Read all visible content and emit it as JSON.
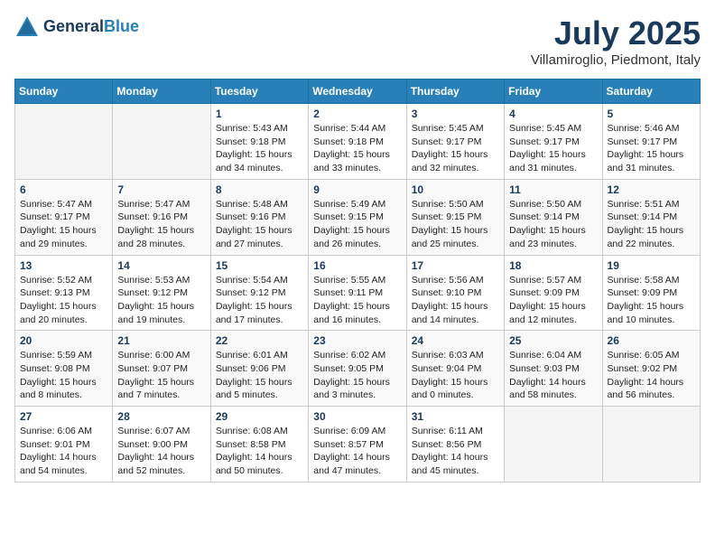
{
  "header": {
    "logo_line1": "General",
    "logo_line2": "Blue",
    "month_title": "July 2025",
    "location": "Villamiroglio, Piedmont, Italy"
  },
  "weekdays": [
    "Sunday",
    "Monday",
    "Tuesday",
    "Wednesday",
    "Thursday",
    "Friday",
    "Saturday"
  ],
  "weeks": [
    [
      {
        "day": "",
        "text": ""
      },
      {
        "day": "",
        "text": ""
      },
      {
        "day": "1",
        "text": "Sunrise: 5:43 AM\nSunset: 9:18 PM\nDaylight: 15 hours\nand 34 minutes."
      },
      {
        "day": "2",
        "text": "Sunrise: 5:44 AM\nSunset: 9:18 PM\nDaylight: 15 hours\nand 33 minutes."
      },
      {
        "day": "3",
        "text": "Sunrise: 5:45 AM\nSunset: 9:17 PM\nDaylight: 15 hours\nand 32 minutes."
      },
      {
        "day": "4",
        "text": "Sunrise: 5:45 AM\nSunset: 9:17 PM\nDaylight: 15 hours\nand 31 minutes."
      },
      {
        "day": "5",
        "text": "Sunrise: 5:46 AM\nSunset: 9:17 PM\nDaylight: 15 hours\nand 31 minutes."
      }
    ],
    [
      {
        "day": "6",
        "text": "Sunrise: 5:47 AM\nSunset: 9:17 PM\nDaylight: 15 hours\nand 29 minutes."
      },
      {
        "day": "7",
        "text": "Sunrise: 5:47 AM\nSunset: 9:16 PM\nDaylight: 15 hours\nand 28 minutes."
      },
      {
        "day": "8",
        "text": "Sunrise: 5:48 AM\nSunset: 9:16 PM\nDaylight: 15 hours\nand 27 minutes."
      },
      {
        "day": "9",
        "text": "Sunrise: 5:49 AM\nSunset: 9:15 PM\nDaylight: 15 hours\nand 26 minutes."
      },
      {
        "day": "10",
        "text": "Sunrise: 5:50 AM\nSunset: 9:15 PM\nDaylight: 15 hours\nand 25 minutes."
      },
      {
        "day": "11",
        "text": "Sunrise: 5:50 AM\nSunset: 9:14 PM\nDaylight: 15 hours\nand 23 minutes."
      },
      {
        "day": "12",
        "text": "Sunrise: 5:51 AM\nSunset: 9:14 PM\nDaylight: 15 hours\nand 22 minutes."
      }
    ],
    [
      {
        "day": "13",
        "text": "Sunrise: 5:52 AM\nSunset: 9:13 PM\nDaylight: 15 hours\nand 20 minutes."
      },
      {
        "day": "14",
        "text": "Sunrise: 5:53 AM\nSunset: 9:12 PM\nDaylight: 15 hours\nand 19 minutes."
      },
      {
        "day": "15",
        "text": "Sunrise: 5:54 AM\nSunset: 9:12 PM\nDaylight: 15 hours\nand 17 minutes."
      },
      {
        "day": "16",
        "text": "Sunrise: 5:55 AM\nSunset: 9:11 PM\nDaylight: 15 hours\nand 16 minutes."
      },
      {
        "day": "17",
        "text": "Sunrise: 5:56 AM\nSunset: 9:10 PM\nDaylight: 15 hours\nand 14 minutes."
      },
      {
        "day": "18",
        "text": "Sunrise: 5:57 AM\nSunset: 9:09 PM\nDaylight: 15 hours\nand 12 minutes."
      },
      {
        "day": "19",
        "text": "Sunrise: 5:58 AM\nSunset: 9:09 PM\nDaylight: 15 hours\nand 10 minutes."
      }
    ],
    [
      {
        "day": "20",
        "text": "Sunrise: 5:59 AM\nSunset: 9:08 PM\nDaylight: 15 hours\nand 8 minutes."
      },
      {
        "day": "21",
        "text": "Sunrise: 6:00 AM\nSunset: 9:07 PM\nDaylight: 15 hours\nand 7 minutes."
      },
      {
        "day": "22",
        "text": "Sunrise: 6:01 AM\nSunset: 9:06 PM\nDaylight: 15 hours\nand 5 minutes."
      },
      {
        "day": "23",
        "text": "Sunrise: 6:02 AM\nSunset: 9:05 PM\nDaylight: 15 hours\nand 3 minutes."
      },
      {
        "day": "24",
        "text": "Sunrise: 6:03 AM\nSunset: 9:04 PM\nDaylight: 15 hours\nand 0 minutes."
      },
      {
        "day": "25",
        "text": "Sunrise: 6:04 AM\nSunset: 9:03 PM\nDaylight: 14 hours\nand 58 minutes."
      },
      {
        "day": "26",
        "text": "Sunrise: 6:05 AM\nSunset: 9:02 PM\nDaylight: 14 hours\nand 56 minutes."
      }
    ],
    [
      {
        "day": "27",
        "text": "Sunrise: 6:06 AM\nSunset: 9:01 PM\nDaylight: 14 hours\nand 54 minutes."
      },
      {
        "day": "28",
        "text": "Sunrise: 6:07 AM\nSunset: 9:00 PM\nDaylight: 14 hours\nand 52 minutes."
      },
      {
        "day": "29",
        "text": "Sunrise: 6:08 AM\nSunset: 8:58 PM\nDaylight: 14 hours\nand 50 minutes."
      },
      {
        "day": "30",
        "text": "Sunrise: 6:09 AM\nSunset: 8:57 PM\nDaylight: 14 hours\nand 47 minutes."
      },
      {
        "day": "31",
        "text": "Sunrise: 6:11 AM\nSunset: 8:56 PM\nDaylight: 14 hours\nand 45 minutes."
      },
      {
        "day": "",
        "text": ""
      },
      {
        "day": "",
        "text": ""
      }
    ]
  ]
}
